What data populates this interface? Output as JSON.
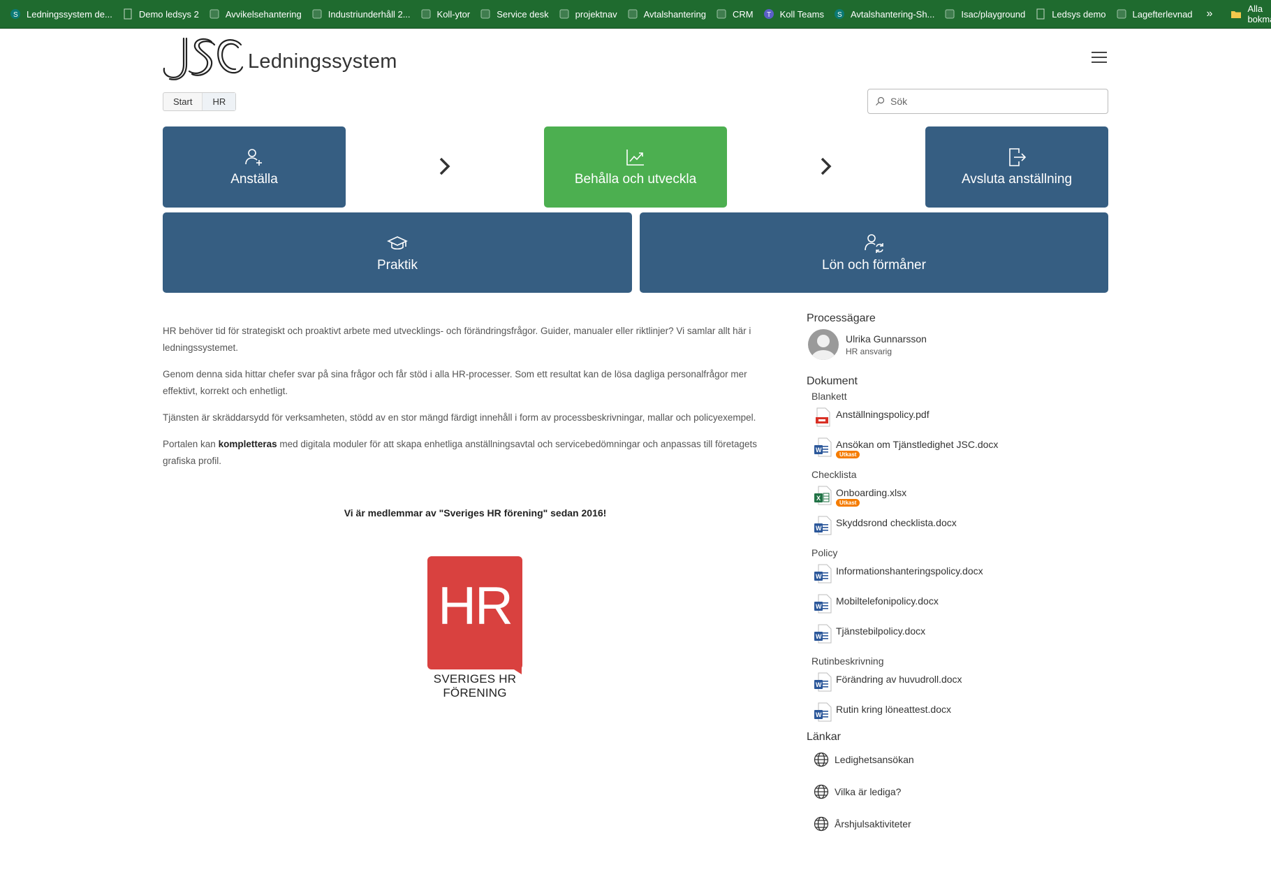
{
  "bookmarks": {
    "items": [
      {
        "label": "Ledningssystem de...",
        "icon": "sharepoint-icon"
      },
      {
        "label": "Demo ledsys 2",
        "icon": "page-icon"
      },
      {
        "label": "Avvikelsehantering",
        "icon": "sharepoint-page-icon"
      },
      {
        "label": "Industriunderhåll 2...",
        "icon": "sharepoint-page-icon"
      },
      {
        "label": "Koll-ytor",
        "icon": "sharepoint-page-icon"
      },
      {
        "label": "Service desk",
        "icon": "sharepoint-page-icon"
      },
      {
        "label": "projektnav",
        "icon": "sharepoint-page-icon"
      },
      {
        "label": "Avtalshantering",
        "icon": "sharepoint-page-icon"
      },
      {
        "label": "CRM",
        "icon": "sharepoint-page-icon"
      },
      {
        "label": "Koll Teams",
        "icon": "teams-icon"
      },
      {
        "label": "Avtalshantering-Sh...",
        "icon": "sharepoint-icon"
      },
      {
        "label": "Isac/playground",
        "icon": "sharepoint-page-icon"
      },
      {
        "label": "Ledsys demo",
        "icon": "page-icon"
      },
      {
        "label": "Lagefterlevnad",
        "icon": "sharepoint-page-icon"
      }
    ],
    "more": "»",
    "all": "Alla bokmärken"
  },
  "header": {
    "brand": "Ledningssystem"
  },
  "breadcrumb": [
    "Start",
    "HR"
  ],
  "search": {
    "placeholder": "Sök"
  },
  "tiles": [
    {
      "label": "Anställa",
      "icon": "person-add-icon",
      "color": "#365e82"
    },
    {
      "label": "Behålla och utveckla",
      "icon": "chart-growth-icon",
      "color": "#4caf50"
    },
    {
      "label": "Avsluta anställning",
      "icon": "exit-icon",
      "color": "#365e82"
    },
    {
      "label": "Praktik",
      "icon": "graduation-cap-icon",
      "color": "#365e82"
    },
    {
      "label": "Lön och förmåner",
      "icon": "person-sync-icon",
      "color": "#365e82"
    }
  ],
  "main": {
    "p1": "HR behöver tid för strategiskt och proaktivt arbete med utvecklings- och förändringsfrågor. Guider, manualer eller riktlinjer? Vi samlar allt här i ledningssystemet.",
    "p2": "Genom denna sida hittar chefer svar på sina frågor och får stöd i alla HR-processer. Som ett resultat kan de lösa dagliga personalfrågor mer effektivt, korrekt och enhetligt.",
    "p3": "Tjänsten är skräddarsydd för verksamheten, stödd av en stor mängd färdigt innehåll i form av processbeskrivningar, mallar och policyexempel.",
    "p4_before": "Portalen kan ",
    "p4_bold": "kompletteras",
    "p4_after": " med digitala moduler för att skapa enhetliga anställningsavtal och servicebedömningar och anpassas till företagets grafiska profil.",
    "member": "Vi är medlemmar av \"Sveriges HR förening\" sedan 2016!",
    "hr_logo_text": "HR",
    "hr_logo_caption": "SVERIGES HR FÖRENING"
  },
  "sidebar": {
    "owner_heading": "Processägare",
    "owner_name": "Ulrika Gunnarsson",
    "owner_role": "HR ansvarig",
    "docs_heading": "Dokument",
    "categories": [
      {
        "name": "Blankett",
        "docs": [
          {
            "name": "Anställningspolicy.pdf",
            "type": "pdf-icon",
            "badge": ""
          },
          {
            "name": "Ansökan om Tjänstledighet JSC.docx",
            "type": "word-icon",
            "badge": "Utkast"
          }
        ]
      },
      {
        "name": "Checklista",
        "docs": [
          {
            "name": "Onboarding.xlsx",
            "type": "excel-icon",
            "badge": "Utkast"
          },
          {
            "name": "Skyddsrond checklista.docx",
            "type": "word-icon",
            "badge": ""
          }
        ]
      },
      {
        "name": "Policy",
        "docs": [
          {
            "name": "Informationshanteringspolicy.docx",
            "type": "word-icon",
            "badge": ""
          },
          {
            "name": "Mobiltelefonipolicy.docx",
            "type": "word-icon",
            "badge": ""
          },
          {
            "name": "Tjänstebilpolicy.docx",
            "type": "word-icon",
            "badge": ""
          }
        ]
      },
      {
        "name": "Rutinbeskrivning",
        "docs": [
          {
            "name": "Förändring av huvudroll.docx",
            "type": "word-icon",
            "badge": ""
          },
          {
            "name": "Rutin kring löneattest.docx",
            "type": "word-icon",
            "badge": ""
          }
        ]
      }
    ],
    "links_heading": "Länkar",
    "links": [
      "Ledighetsansökan",
      "Vilka är lediga?",
      "Årshjulsaktiviteter"
    ]
  },
  "colors": {
    "tile_blue": "#365e82",
    "tile_green": "#4caf50",
    "bookmarks_bg": "#1f6b2f",
    "badge": "#f57c00",
    "hr_red": "#d9413f"
  }
}
